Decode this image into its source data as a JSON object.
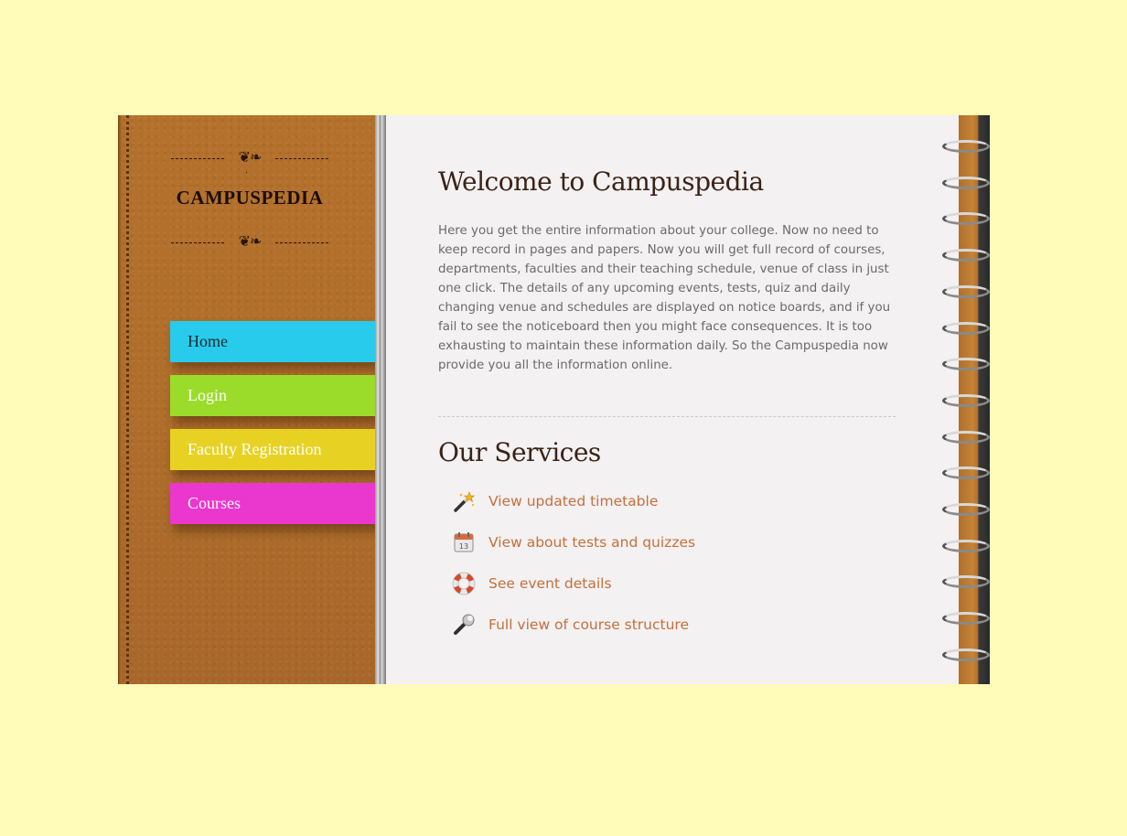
{
  "brand": {
    "name": "CAMPUSPEDIA"
  },
  "nav": {
    "items": [
      {
        "label": "Home"
      },
      {
        "label": "Login"
      },
      {
        "label": "Faculty Registration"
      },
      {
        "label": "Courses"
      }
    ]
  },
  "main": {
    "title": "Welcome to Campuspedia",
    "intro": "Here you get the entire information about your college. Now no need to keep record in pages and papers. Now you will get full record of courses, departments, faculties and their teaching schedule, venue of class in just one click. The details of any upcoming events, tests, quiz and daily changing venue and schedules are displayed on notice boards, and if you fail to see the noticeboard then you might face consequences. It is too exhausting to maintain these information daily. So the Campuspedia now provide you all the information online.",
    "services_title": "Our Services",
    "services": [
      {
        "label": "View updated timetable",
        "icon": "magic-wand-icon"
      },
      {
        "label": "View about tests and quizzes",
        "icon": "calendar-icon",
        "icon_text": "13"
      },
      {
        "label": "See event details",
        "icon": "lifebuoy-icon"
      },
      {
        "label": "Full view of course structure",
        "icon": "wrench-icon"
      }
    ]
  },
  "colors": {
    "background": "#fffbb8",
    "tab_home": "#28cbec",
    "tab_login": "#9adc29",
    "tab_faculty": "#e7d224",
    "tab_courses": "#ea37cd",
    "service_link": "#c66f39"
  }
}
